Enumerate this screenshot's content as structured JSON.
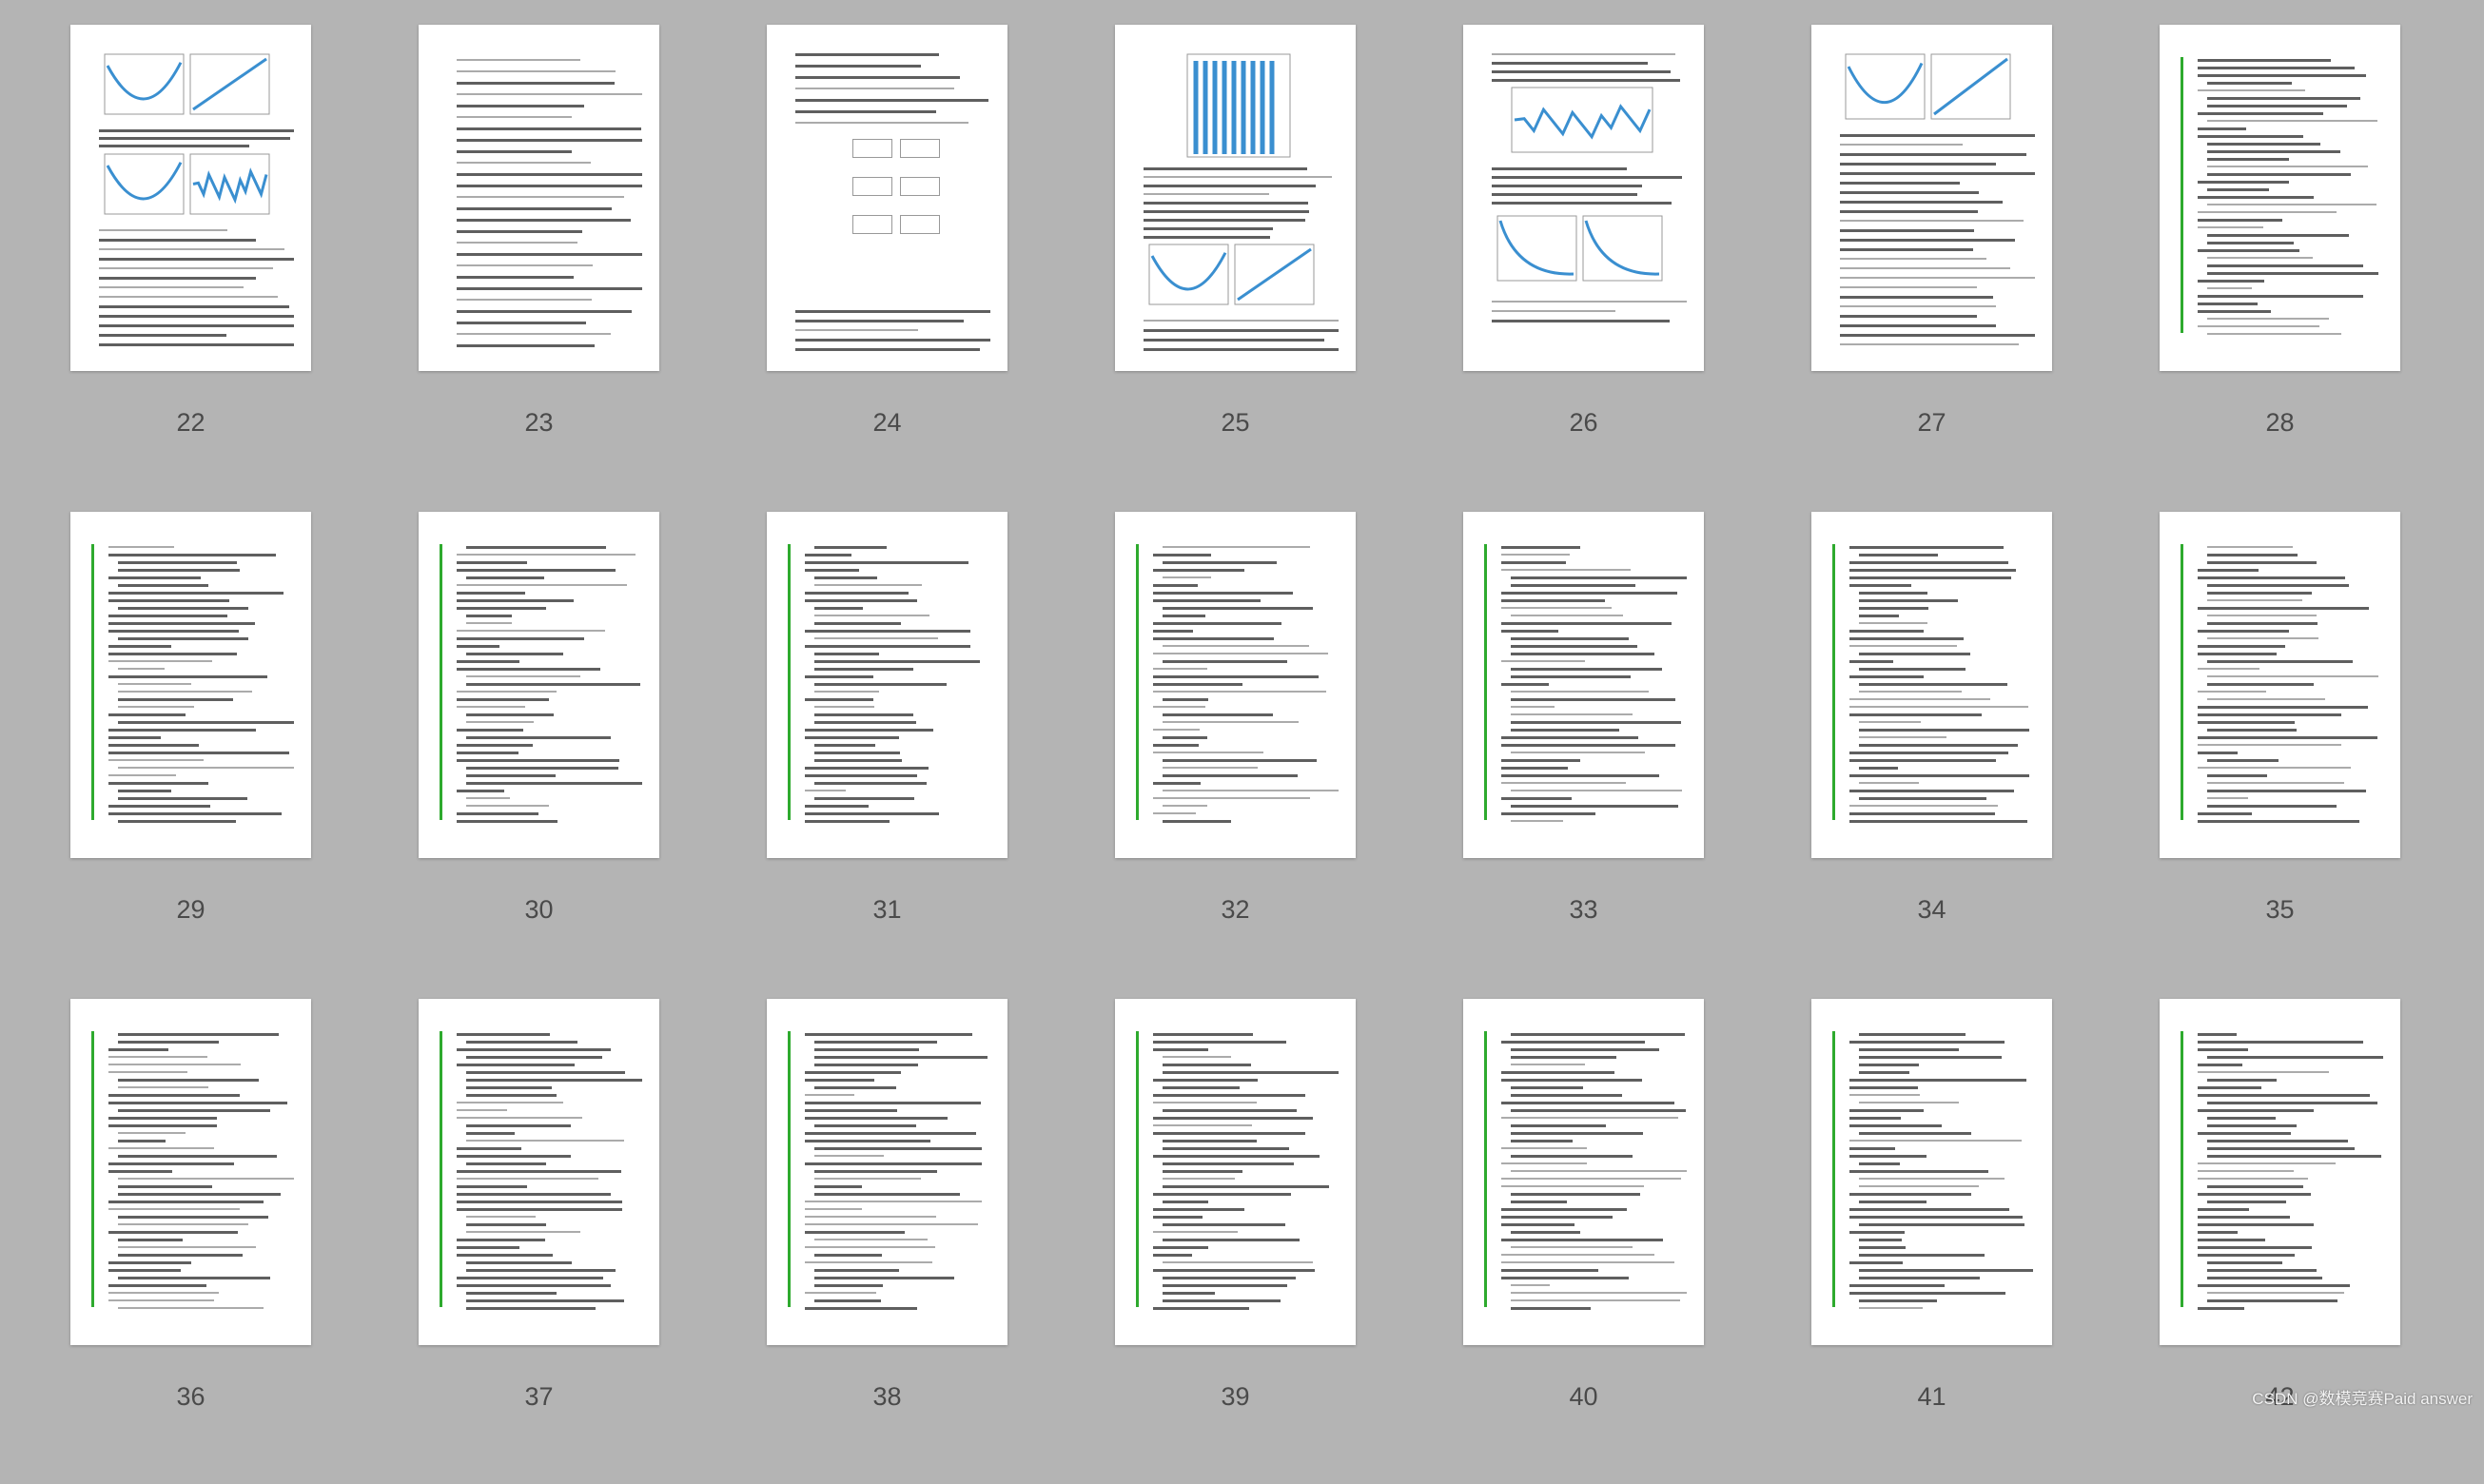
{
  "thumbnails": [
    {
      "number": "22",
      "kind": "figures"
    },
    {
      "number": "23",
      "kind": "equations"
    },
    {
      "number": "24",
      "kind": "flowchart"
    },
    {
      "number": "25",
      "kind": "figures"
    },
    {
      "number": "26",
      "kind": "figures"
    },
    {
      "number": "27",
      "kind": "figures"
    },
    {
      "number": "28",
      "kind": "code"
    },
    {
      "number": "29",
      "kind": "code"
    },
    {
      "number": "30",
      "kind": "code"
    },
    {
      "number": "31",
      "kind": "code"
    },
    {
      "number": "32",
      "kind": "code"
    },
    {
      "number": "33",
      "kind": "code"
    },
    {
      "number": "34",
      "kind": "code"
    },
    {
      "number": "35",
      "kind": "code"
    },
    {
      "number": "36",
      "kind": "code"
    },
    {
      "number": "37",
      "kind": "code"
    },
    {
      "number": "38",
      "kind": "code"
    },
    {
      "number": "39",
      "kind": "code"
    },
    {
      "number": "40",
      "kind": "code"
    },
    {
      "number": "41",
      "kind": "code"
    },
    {
      "number": "42",
      "kind": "code"
    }
  ],
  "watermark": "CSDN @数模竞赛Paid answer",
  "colors": {
    "background": "#b4b4b4",
    "page": "#ffffff",
    "code_bar": "#2eaa2e",
    "plot_line": "#3a8fd0"
  }
}
